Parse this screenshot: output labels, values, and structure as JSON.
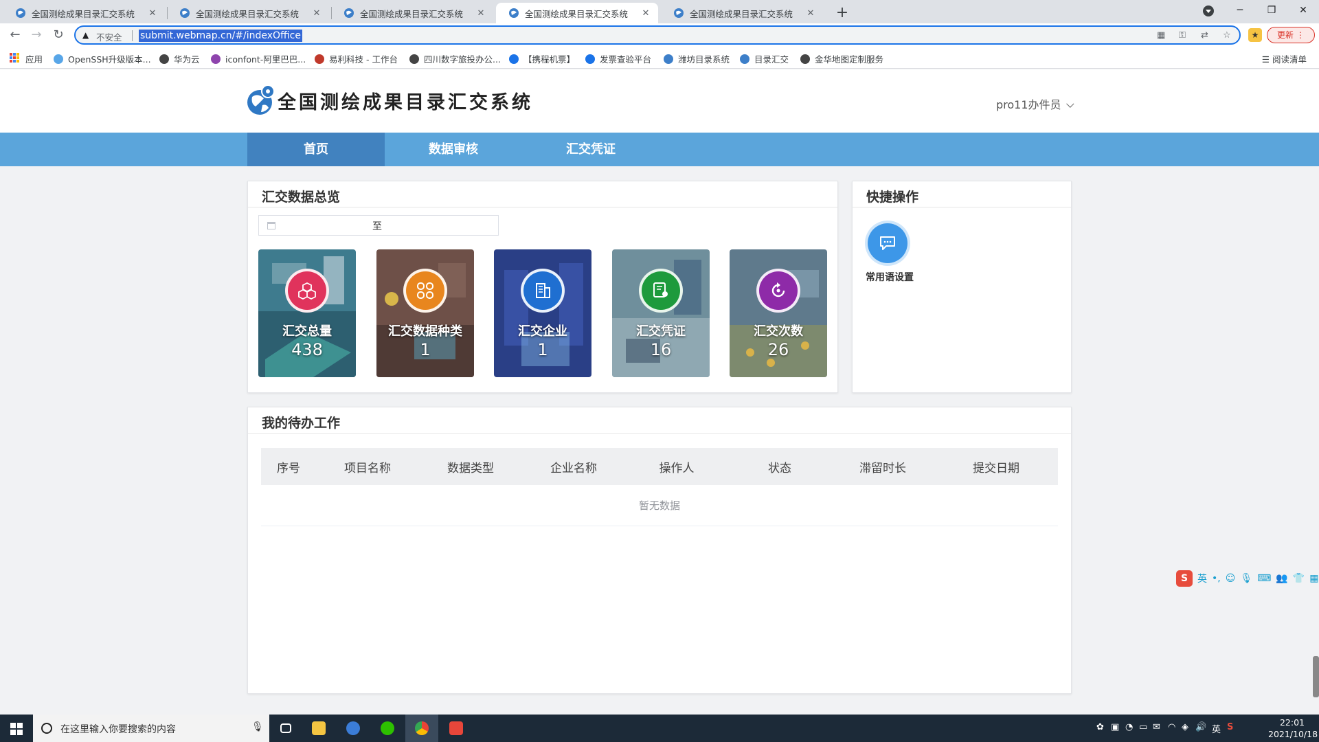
{
  "browser": {
    "tabs": [
      {
        "title": "全国测绘成果目录汇交系统",
        "active": false
      },
      {
        "title": "全国测绘成果目录汇交系统",
        "active": false
      },
      {
        "title": "全国测绘成果目录汇交系统",
        "active": false
      },
      {
        "title": "全国测绘成果目录汇交系统",
        "active": true
      },
      {
        "title": "全国测绘成果目录汇交系统",
        "active": false
      }
    ],
    "insecure_label": "不安全",
    "url": "submit.webmap.cn/#/indexOffice",
    "update_label": "更新",
    "bookmarks": [
      "应用",
      "OpenSSH升级版本...",
      "华为云",
      "iconfont-阿里巴巴...",
      "易利科技 - 工作台",
      "四川数字旅投办公...",
      "【携程机票】",
      "发票查验平台",
      "潍坊目录系统",
      "目录汇交",
      "金华地图定制服务"
    ],
    "reading_list": "阅读清单"
  },
  "site": {
    "title": "全国测绘成果目录汇交系统",
    "user": "pro11办件员",
    "nav": [
      {
        "label": "首页",
        "active": true
      },
      {
        "label": "数据审核",
        "active": false
      },
      {
        "label": "汇交凭证",
        "active": false
      }
    ]
  },
  "overview": {
    "title": "汇交数据总览",
    "date_separator": "至",
    "stats": [
      {
        "label": "汇交总量",
        "value": "438",
        "accent": "#e0335c",
        "icon": "cubes-icon"
      },
      {
        "label": "汇交数据种类",
        "value": "1",
        "accent": "#e8861e",
        "icon": "grid-icon"
      },
      {
        "label": "汇交企业",
        "value": "1",
        "accent": "#1f6fd1",
        "icon": "building-icon"
      },
      {
        "label": "汇交凭证",
        "value": "16",
        "accent": "#1e9a3c",
        "icon": "certificate-icon"
      },
      {
        "label": "汇交次数",
        "value": "26",
        "accent": "#8e2aa8",
        "icon": "refresh-icon"
      }
    ]
  },
  "quick_ops": {
    "title": "快捷操作",
    "items": [
      {
        "label": "常用语设置",
        "icon": "chat-icon"
      }
    ]
  },
  "todo": {
    "title": "我的待办工作",
    "columns": [
      "序号",
      "项目名称",
      "数据类型",
      "企业名称",
      "操作人",
      "状态",
      "滞留时长",
      "提交日期"
    ],
    "empty_text": "暂无数据"
  },
  "ime": {
    "lang": "英"
  },
  "taskbar": {
    "search_placeholder": "在这里输入你要搜索的内容",
    "tray_lang": "英",
    "time": "22:01",
    "date": "2021/10/18"
  }
}
